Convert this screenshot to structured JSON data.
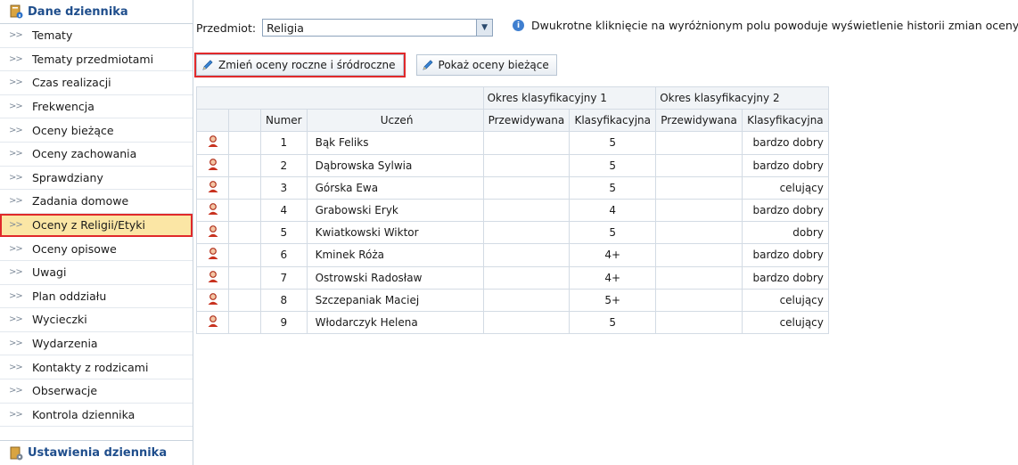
{
  "sidebar": {
    "header": "Dane dziennika",
    "items": [
      {
        "label": "Tematy"
      },
      {
        "label": "Tematy przedmiotami"
      },
      {
        "label": "Czas realizacji"
      },
      {
        "label": "Frekwencja"
      },
      {
        "label": "Oceny bieżące"
      },
      {
        "label": "Oceny zachowania"
      },
      {
        "label": "Sprawdziany"
      },
      {
        "label": "Zadania domowe"
      },
      {
        "label": "Oceny z Religii/Etyki",
        "active": true
      },
      {
        "label": "Oceny opisowe"
      },
      {
        "label": "Uwagi"
      },
      {
        "label": "Plan oddziału"
      },
      {
        "label": "Wycieczki"
      },
      {
        "label": "Wydarzenia"
      },
      {
        "label": "Kontakty z rodzicami"
      },
      {
        "label": "Obserwacje"
      },
      {
        "label": "Kontrola dziennika"
      }
    ],
    "footer": "Ustawienia dziennika"
  },
  "toolbar": {
    "subject_label": "Przedmiot:",
    "subject_value": "Religia",
    "info_text": "Dwukrotne kliknięcie na wyróżnionym polu powoduje wyświetlenie historii zmian oceny.",
    "btn_change": "Zmień oceny roczne i śródroczne",
    "btn_show": "Pokaż oceny bieżące"
  },
  "grid": {
    "group1": "Okres klasyfikacyjny 1",
    "group2": "Okres klasyfikacyjny 2",
    "col_num": "Numer",
    "col_student": "Uczeń",
    "col_pred": "Przewidywana",
    "col_class": "Klasyfikacyjna",
    "rows": [
      {
        "num": "1",
        "name": "Bąk Feliks",
        "p1": "",
        "k1": "5",
        "p2": "",
        "k2": "bardzo dobry"
      },
      {
        "num": "2",
        "name": "Dąbrowska Sylwia",
        "p1": "",
        "k1": "5",
        "p2": "",
        "k2": "bardzo dobry"
      },
      {
        "num": "3",
        "name": "Górska Ewa",
        "p1": "",
        "k1": "5",
        "p2": "",
        "k2": "celujący"
      },
      {
        "num": "4",
        "name": "Grabowski Eryk",
        "p1": "",
        "k1": "4",
        "p2": "",
        "k2": "bardzo dobry"
      },
      {
        "num": "5",
        "name": "Kwiatkowski Wiktor",
        "p1": "",
        "k1": "5",
        "p2": "",
        "k2": "dobry"
      },
      {
        "num": "6",
        "name": "Kminek Róża",
        "p1": "",
        "k1": "4+",
        "p2": "",
        "k2": "bardzo dobry"
      },
      {
        "num": "7",
        "name": "Ostrowski Radosław",
        "p1": "",
        "k1": "4+",
        "p2": "",
        "k2": "bardzo dobry"
      },
      {
        "num": "8",
        "name": "Szczepaniak Maciej",
        "p1": "",
        "k1": "5+",
        "p2": "",
        "k2": "celujący"
      },
      {
        "num": "9",
        "name": "Włodarczyk Helena",
        "p1": "",
        "k1": "5",
        "p2": "",
        "k2": "celujący"
      }
    ]
  },
  "colors": {
    "accent": "#1f4e8c",
    "highlight_border": "#e0292b",
    "active_bg": "#fbe6a5"
  }
}
